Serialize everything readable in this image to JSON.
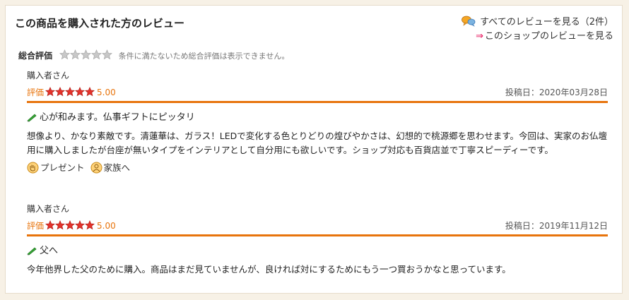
{
  "section": {
    "title": "この商品を購入された方のレビュー",
    "all_reviews_link": "すべてのレビューを見る（2件）",
    "shop_reviews_link": "このショップのレビューを見る"
  },
  "summary": {
    "label": "総合評価",
    "stars_filled": 0,
    "stars_total": 5,
    "note": "条件に満たないため総合評価は表示できません。"
  },
  "reviews": [
    {
      "reviewer": "購入者さん",
      "rating_label": "評価",
      "rating": 5,
      "score": "5.00",
      "date": "投稿日：2020年03月28日",
      "headline": "心が和みます。仏事ギフトにピッタリ",
      "body": "想像より、かなり素敵です。清蓮華は、ガラス！LEDで変化する色とりどりの煌びやかさは、幻想的で桃源郷を思わせます。今回は、実家のお仏壇用に購入しましたが台座が無いタイプをインテリアとして自分用にも欲しいです。ショップ対応も百貨店並で丁寧スピーディーです。",
      "tags": [
        {
          "icon": "present-hand-icon",
          "label": "プレゼント"
        },
        {
          "icon": "family-person-icon",
          "label": "家族へ"
        }
      ]
    },
    {
      "reviewer": "購入者さん",
      "rating_label": "評価",
      "rating": 5,
      "score": "5.00",
      "date": "投稿日：2019年11月12日",
      "headline": "父へ",
      "body": "今年他界した父のために購入。商品はまだ見ていませんが、良ければ対にするためにもう一つ買おうかなと思っています。",
      "tags": []
    }
  ],
  "colors": {
    "accent_orange": "#e8740c",
    "star_red": "#e4322b",
    "star_empty": "#c8c8c8",
    "link_arrow": "#e5004f"
  }
}
